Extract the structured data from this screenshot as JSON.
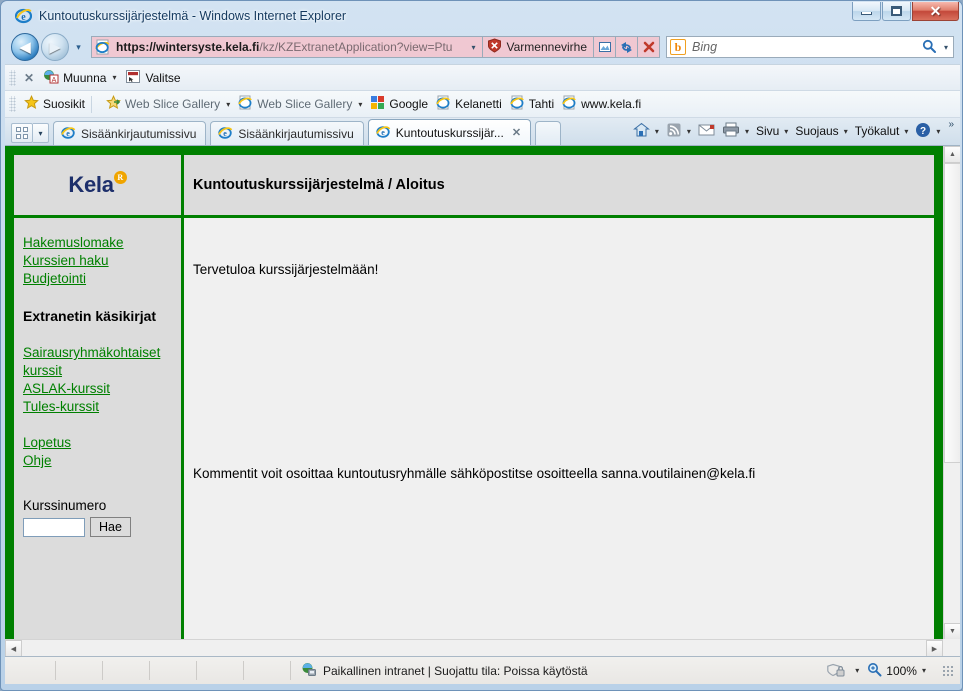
{
  "window": {
    "title": "Kuntoutuskurssijärjestelmä - Windows Internet Explorer",
    "minimize_label": "Pienennä",
    "maximize_label": "Suurenna",
    "close_label": "Sulje"
  },
  "navigation": {
    "back_label": "Takaisin",
    "forward_label": "Eteenpäin",
    "history_caret": "▾",
    "address": {
      "url_bold": "https://wintersyste.kela.fi",
      "url_rest": "/kz/KZExtranetApplication?view=Ptu",
      "dropdown_caret": "▾"
    },
    "cert_error_label": "Varmennevirhe",
    "compat_icon": "compatibility-view-icon",
    "refresh_icon": "refresh-icon",
    "stop_icon": "stop-icon",
    "search": {
      "provider": "b",
      "placeholder": "Bing",
      "go_icon": "🔍",
      "dropdown_caret": "▾"
    }
  },
  "pdf_toolbar": {
    "close_label": "✕",
    "items": [
      {
        "label": "Muunna",
        "caret": "▾",
        "icon": "pdf-convert-icon"
      },
      {
        "label": "Valitse",
        "caret": "",
        "icon": "pdf-select-icon"
      }
    ]
  },
  "favorites_bar": {
    "favorites_label": "Suosikit",
    "items": [
      {
        "label": "Web Slice Gallery",
        "caret": "▾",
        "icon": "web-slice-icon"
      },
      {
        "label": "Web Slice Gallery",
        "caret": "▾",
        "icon": "ie-icon"
      },
      {
        "label": "Google",
        "caret": "",
        "icon": "google-icon"
      },
      {
        "label": "Kelanetti",
        "caret": "",
        "icon": "ie-icon"
      },
      {
        "label": "Tahti",
        "caret": "",
        "icon": "ie-icon"
      },
      {
        "label": "www.kela.fi",
        "caret": "",
        "icon": "ie-icon"
      }
    ]
  },
  "tabs": {
    "quick_tabs_label": "Pikavälilehdet",
    "items": [
      {
        "label": "Sisäänkirjautumissivu",
        "active": false,
        "close": ""
      },
      {
        "label": "Sisäänkirjautumissivu",
        "active": false,
        "close": ""
      },
      {
        "label": "Kuntoutuskurssijär...",
        "active": true,
        "close": "✕"
      }
    ],
    "command_bar": {
      "home_icon": "home-icon",
      "feeds_icon": "rss-icon",
      "mail_icon": "mail-icon",
      "print_icon": "print-icon",
      "menus": [
        {
          "label": "Sivu",
          "caret": "▾"
        },
        {
          "label": "Suojaus",
          "caret": "▾"
        },
        {
          "label": "Työkalut",
          "caret": "▾"
        }
      ],
      "help_caret": "▾",
      "overflow": "»"
    }
  },
  "page": {
    "brand": {
      "name": "Kela",
      "registered_mark": "R"
    },
    "header_title": "Kuntoutuskurssijärjestelmä / Aloitus",
    "sidebar": {
      "links_top": [
        "Hakemuslomake",
        "Kurssien haku",
        "Budjetointi"
      ],
      "heading": "Extranetin käsikirjat",
      "links_manuals": [
        "Sairausryhmäkohtaiset kurssit",
        "ASLAK-kurssit",
        "Tules-kurssit"
      ],
      "links_bottom": [
        "Lopetus",
        "Ohje"
      ],
      "course_number_label": "Kurssinumero",
      "course_number_value": "",
      "search_button_label": "Hae"
    },
    "content": {
      "welcome": "Tervetuloa kurssijärjestelmään!",
      "comment": "Kommentit voit osoittaa kuntoutusryhmälle sähköpostitse osoitteella sanna.voutilainen@kela.fi"
    },
    "colors": {
      "frame_green": "#008000",
      "panel_gray": "#dcdcdc",
      "content_gray": "#f0f0f0",
      "link_green": "#008000",
      "brand_navy": "#1d2f6b",
      "brand_orange": "#f0a500"
    }
  },
  "status_bar": {
    "zone_text": "Paikallinen intranet | Suojattu tila: Poissa käytöstä",
    "protected_icon": "protected-mode-icon",
    "protected_caret": "▾",
    "zoom_label": "100%",
    "zoom_caret": "▾"
  }
}
